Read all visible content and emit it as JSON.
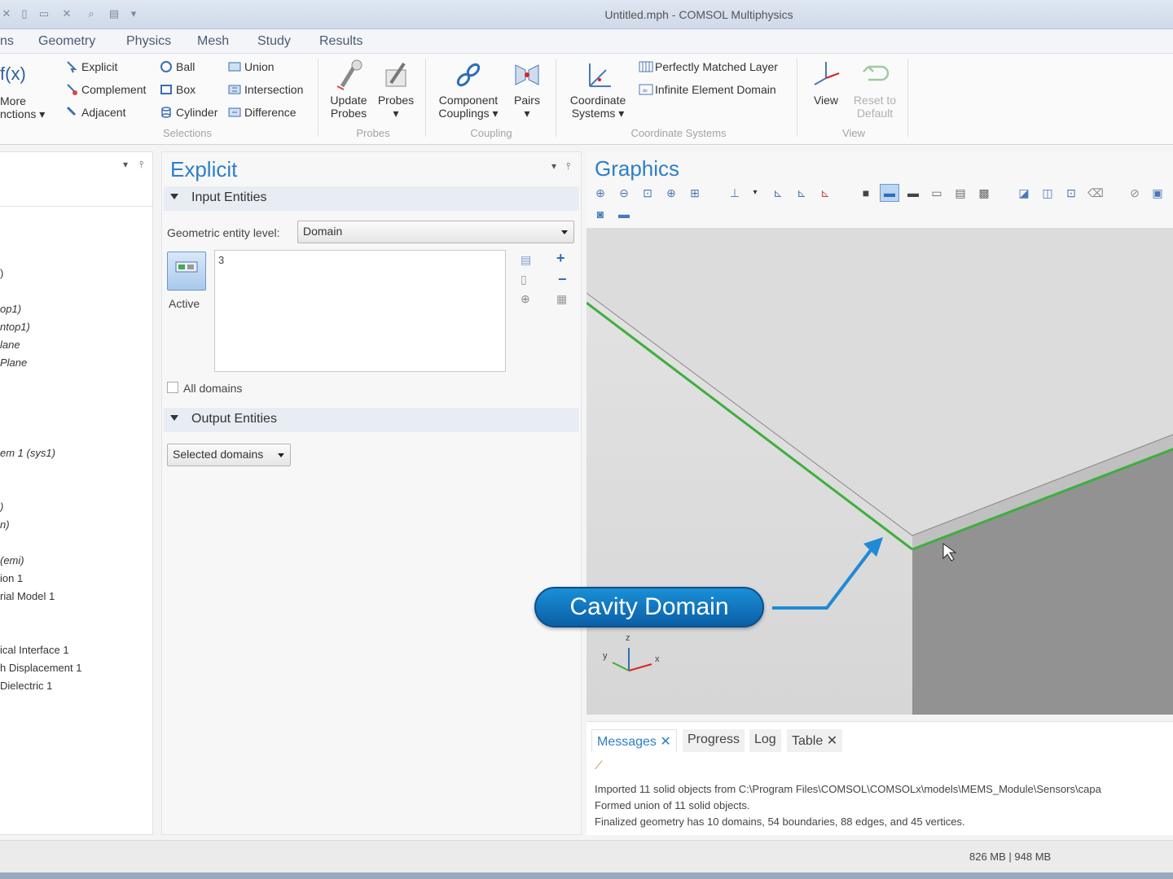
{
  "window": {
    "title": "Untitled.mph - COMSOL Multiphysics"
  },
  "menu": {
    "tabs": [
      "ns",
      "Geometry",
      "Physics",
      "Mesh",
      "Study",
      "Results"
    ]
  },
  "ribbon": {
    "functions": {
      "fx": "f(x)",
      "more1": "More",
      "more2": "nctions ▾"
    },
    "selections": {
      "explicit": "Explicit",
      "complement": "Complement",
      "adjacent": "Adjacent",
      "ball": "Ball",
      "box": "Box",
      "cylinder": "Cylinder",
      "union": "Union",
      "intersection": "Intersection",
      "difference": "Difference",
      "group": "Selections"
    },
    "probes": {
      "update1": "Update",
      "update2": "Probes",
      "probes": "Probes",
      "group": "Probes"
    },
    "coupling": {
      "comp1": "Component",
      "comp2": "Couplings ▾",
      "pairs": "Pairs",
      "group": "Coupling"
    },
    "coord": {
      "cs1": "Coordinate",
      "cs2": "Systems ▾",
      "pml": "Perfectly Matched Layer",
      "ied": "Infinite Element Domain",
      "group": "Coordinate Systems"
    },
    "view": {
      "view": "View",
      "reset1": "Reset to",
      "reset2": "Default",
      "group": "View"
    }
  },
  "tree": {
    "items": [
      ")",
      "op1)",
      "ntop1)",
      "lane",
      "Plane",
      "em 1 (sys1)",
      ")",
      "n)",
      "(emi)",
      "ion 1",
      "rial Model 1",
      "ical Interface 1",
      "h Displacement 1",
      "Dielectric 1"
    ]
  },
  "settings": {
    "title": "Explicit",
    "input_section": "Input Entities",
    "entity_level_label": "Geometric entity level:",
    "entity_level_value": "Domain",
    "list_value": "3",
    "active_label": "Active",
    "all_domains_label": "All domains",
    "output_section": "Output Entities",
    "output_value": "Selected domains"
  },
  "graphics": {
    "title": "Graphics",
    "callout": "Cavity Domain",
    "axis_x": "x",
    "axis_y": "y",
    "axis_z": "z"
  },
  "messages": {
    "tabs": [
      "Messages ✕",
      "Progress",
      "Log",
      "Table ✕"
    ],
    "lines": [
      "Imported 11 solid objects from C:\\Program Files\\COMSOL\\COMSOLx\\models\\MEMS_Module\\Sensors\\capa",
      "Formed union of 11 solid objects.",
      "Finalized geometry has 10 domains, 54 boundaries, 88 edges, and 45 vertices."
    ]
  },
  "status": {
    "memory": "826 MB | 948 MB"
  },
  "colors": {
    "accent": "#2d7fc8",
    "highlight": "#3fae3f",
    "callout": "#0b6fb8"
  }
}
